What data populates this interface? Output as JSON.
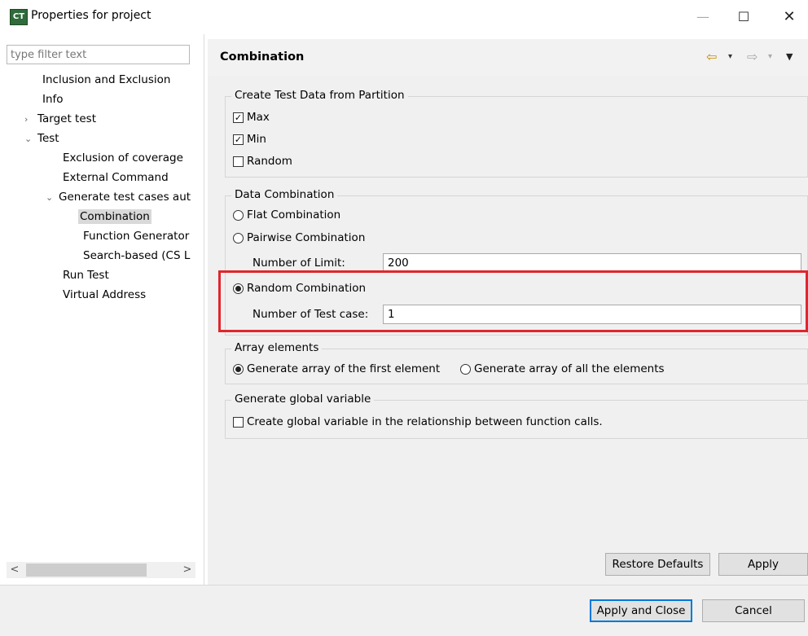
{
  "window": {
    "icon_text": "CT",
    "title": "Properties for project",
    "minimize": "—",
    "maximize": "☐",
    "close": "✕"
  },
  "left": {
    "filter_placeholder": "type filter text",
    "tree": [
      {
        "label": "Inclusion and Exclusion"
      },
      {
        "label": "Info"
      },
      {
        "label": "Target test",
        "twisty": "›"
      },
      {
        "label": "Test",
        "twisty": "⌄"
      },
      {
        "label": "Exclusion of coverage"
      },
      {
        "label": "External Command"
      },
      {
        "label": "Generate test cases aut",
        "twisty": "⌄"
      },
      {
        "label": "Combination"
      },
      {
        "label": "Function Generator"
      },
      {
        "label": "Search-based (CS L"
      },
      {
        "label": "Run Test"
      },
      {
        "label": "Virtual Address"
      }
    ],
    "scroll_left": "<",
    "scroll_right": ">"
  },
  "page": {
    "title": "Combination",
    "nav": {
      "back": "⇦",
      "back_menu": "▾",
      "forward": "⇨",
      "forward_menu": "▾",
      "view_menu": "▼"
    }
  },
  "partition": {
    "title": "Create Test Data from Partition",
    "max": {
      "label": "Max",
      "checked": true
    },
    "min": {
      "label": "Min",
      "checked": true
    },
    "random": {
      "label": "Random",
      "checked": false
    }
  },
  "combination": {
    "title": "Data Combination",
    "flat": {
      "label": "Flat Combination",
      "selected": false
    },
    "pairwise": {
      "label": "Pairwise Combination",
      "selected": false
    },
    "limit_label": "Number of Limit:",
    "limit_value": "200",
    "random": {
      "label": "Random Combination",
      "selected": true
    },
    "testcase_label": "Number of Test case:",
    "testcase_value": "1"
  },
  "array": {
    "title": "Array elements",
    "first": {
      "label": "Generate array of the first element",
      "selected": true
    },
    "all": {
      "label": "Generate array of all the elements",
      "selected": false
    }
  },
  "global": {
    "title": "Generate global variable",
    "option": {
      "label": "Create global variable in the relationship between function calls.",
      "checked": false
    }
  },
  "buttons": {
    "restore_defaults": "Restore Defaults",
    "apply": "Apply",
    "apply_and_close": "Apply and Close",
    "cancel": "Cancel"
  },
  "colors": {
    "highlight": "#e0262d",
    "back_arrow": "#c88c00",
    "default_button_border": "#0078d7"
  }
}
